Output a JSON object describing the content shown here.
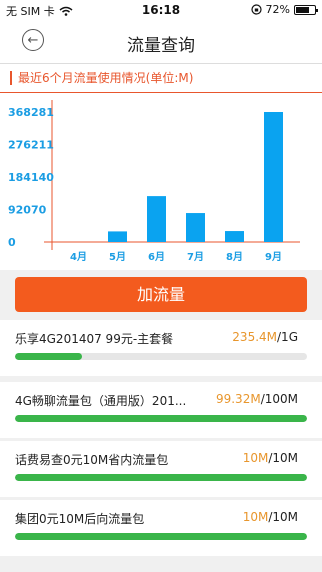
{
  "status_bar": {
    "carrier": "无 SIM 卡",
    "time": "16:18",
    "battery": "72%",
    "battery_level": 0.72
  },
  "nav": {
    "title": "流量查询",
    "back_icon": "back-arrow-icon"
  },
  "chart_data": {
    "type": "bar",
    "title": "最近6个月流量使用情况(单位:M)",
    "categories": [
      "4月",
      "5月",
      "6月",
      "7月",
      "8月",
      "9月"
    ],
    "values": [
      0,
      30000,
      130000,
      82000,
      31000,
      368281
    ],
    "yticks": [
      0,
      92070,
      184140,
      276211,
      368281
    ],
    "ylim": [
      0,
      368281
    ],
    "bar_color": "#0aa3f0",
    "axis_color": "#e8562d",
    "tick_color": "#1b9de3"
  },
  "actions": {
    "add_traffic_label": "加流量"
  },
  "packages": [
    {
      "name": "乐享4G201407 99元-主套餐",
      "used": "235.4M",
      "total": "/1G",
      "fraction": 0.23
    },
    {
      "name": "4G畅聊流量包（通用版）201...",
      "used": "99.32M",
      "total": "/100M",
      "fraction": 1.0
    },
    {
      "name": "话费易查0元10M省内流量包",
      "used": "10M",
      "total": "/10M",
      "fraction": 1.0
    },
    {
      "name": "集团0元10M后向流量包",
      "used": "10M",
      "total": "/10M",
      "fraction": 1.0
    }
  ]
}
